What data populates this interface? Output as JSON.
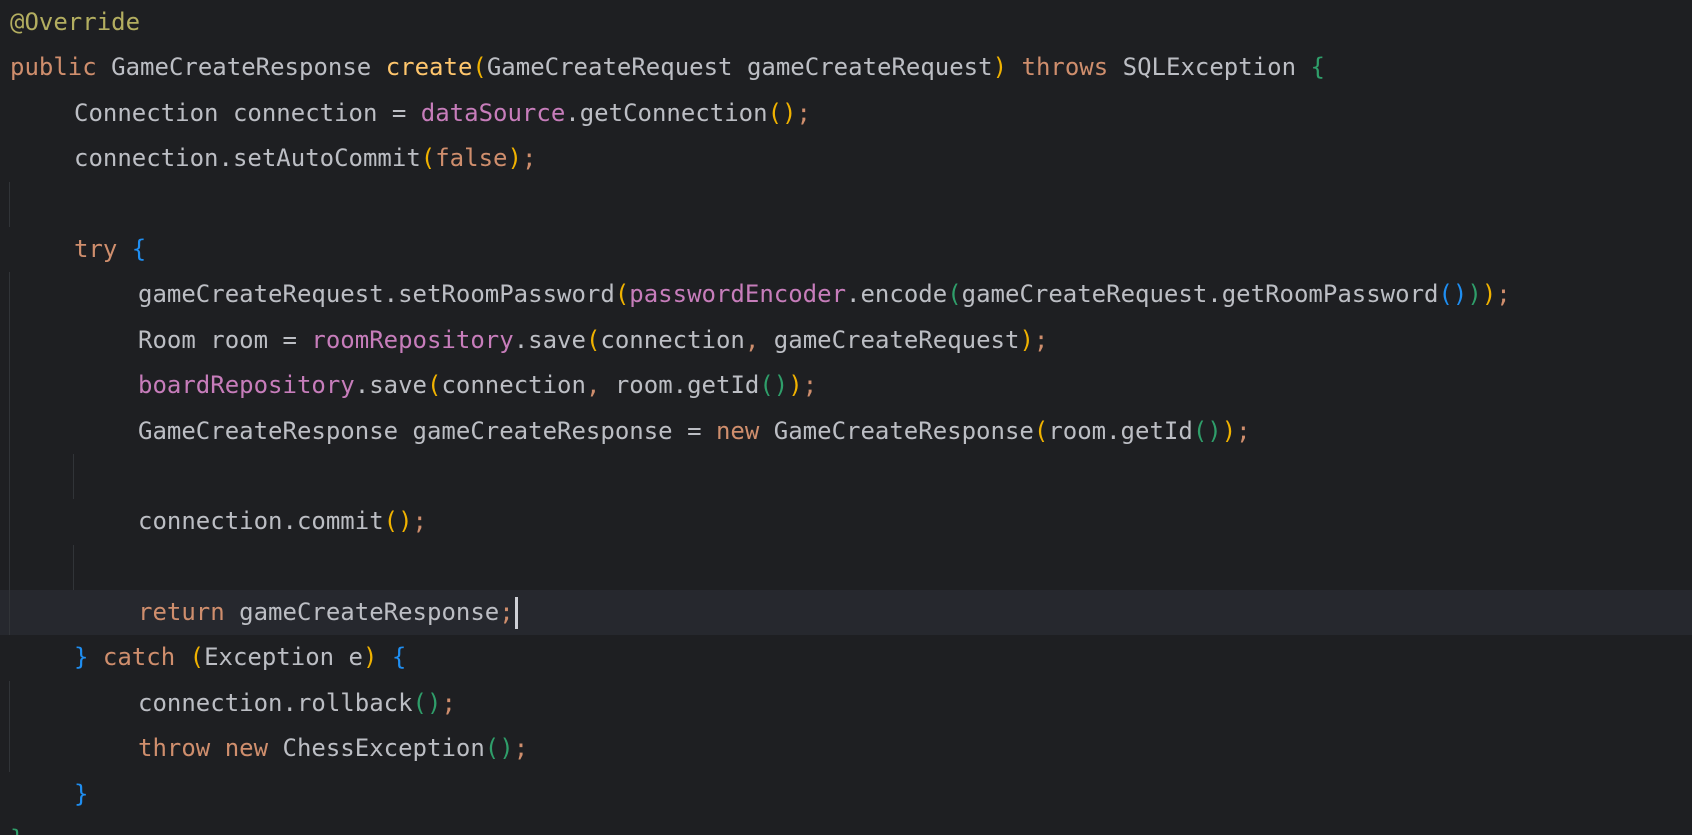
{
  "colors": {
    "background": "#1e1f22",
    "current_line": "#26282e",
    "default": "#bcbec4",
    "keyword": "#cf8e6d",
    "annotation": "#b3ae60",
    "method_decl": "#ffc66d",
    "field": "#c77dbb",
    "paren_1": "#f0b200",
    "paren_2": "#2f9e6a",
    "paren_3": "#1f8ef1"
  },
  "editor": {
    "current_line_index": 13,
    "lines": [
      {
        "indent": 0,
        "tokens": [
          {
            "t": "@Override",
            "c": "annotation"
          }
        ]
      },
      {
        "indent": 0,
        "tokens": [
          {
            "t": "public ",
            "c": "keyword"
          },
          {
            "t": "GameCreateResponse ",
            "c": "default"
          },
          {
            "t": "create",
            "c": "method_decl"
          },
          {
            "t": "(",
            "c": "paren_1"
          },
          {
            "t": "GameCreateRequest gameCreateRequest",
            "c": "default"
          },
          {
            "t": ")",
            "c": "paren_1"
          },
          {
            "t": " throws ",
            "c": "keyword"
          },
          {
            "t": "SQLException ",
            "c": "default"
          },
          {
            "t": "{",
            "c": "paren_2"
          }
        ]
      },
      {
        "indent": 1,
        "tokens": [
          {
            "t": "Connection connection = ",
            "c": "default"
          },
          {
            "t": "dataSource",
            "c": "field"
          },
          {
            "t": ".getConnection",
            "c": "default"
          },
          {
            "t": "()",
            "c": "paren_1"
          },
          {
            "t": ";",
            "c": "keyword"
          }
        ]
      },
      {
        "indent": 1,
        "tokens": [
          {
            "t": "connection.setAutoCommit",
            "c": "default"
          },
          {
            "t": "(",
            "c": "paren_1"
          },
          {
            "t": "false",
            "c": "keyword"
          },
          {
            "t": ")",
            "c": "paren_1"
          },
          {
            "t": ";",
            "c": "keyword"
          }
        ]
      },
      {
        "indent": 0,
        "tokens": []
      },
      {
        "indent": 1,
        "tokens": [
          {
            "t": "try ",
            "c": "keyword"
          },
          {
            "t": "{",
            "c": "paren_3"
          }
        ]
      },
      {
        "indent": 2,
        "tokens": [
          {
            "t": "gameCreateRequest.setRoomPassword",
            "c": "default"
          },
          {
            "t": "(",
            "c": "paren_1"
          },
          {
            "t": "passwordEncoder",
            "c": "field"
          },
          {
            "t": ".encode",
            "c": "default"
          },
          {
            "t": "(",
            "c": "paren_2"
          },
          {
            "t": "gameCreateRequest.getRoomPassword",
            "c": "default"
          },
          {
            "t": "()",
            "c": "paren_3"
          },
          {
            "t": ")",
            "c": "paren_2"
          },
          {
            "t": ")",
            "c": "paren_1"
          },
          {
            "t": ";",
            "c": "keyword"
          }
        ]
      },
      {
        "indent": 2,
        "tokens": [
          {
            "t": "Room room = ",
            "c": "default"
          },
          {
            "t": "roomRepository",
            "c": "field"
          },
          {
            "t": ".save",
            "c": "default"
          },
          {
            "t": "(",
            "c": "paren_1"
          },
          {
            "t": "connection",
            "c": "default"
          },
          {
            "t": ", ",
            "c": "keyword"
          },
          {
            "t": "gameCreateRequest",
            "c": "default"
          },
          {
            "t": ")",
            "c": "paren_1"
          },
          {
            "t": ";",
            "c": "keyword"
          }
        ]
      },
      {
        "indent": 2,
        "tokens": [
          {
            "t": "boardRepository",
            "c": "field"
          },
          {
            "t": ".save",
            "c": "default"
          },
          {
            "t": "(",
            "c": "paren_1"
          },
          {
            "t": "connection",
            "c": "default"
          },
          {
            "t": ", ",
            "c": "keyword"
          },
          {
            "t": "room.getId",
            "c": "default"
          },
          {
            "t": "()",
            "c": "paren_2"
          },
          {
            "t": ")",
            "c": "paren_1"
          },
          {
            "t": ";",
            "c": "keyword"
          }
        ]
      },
      {
        "indent": 2,
        "tokens": [
          {
            "t": "GameCreateResponse gameCreateResponse = ",
            "c": "default"
          },
          {
            "t": "new ",
            "c": "keyword"
          },
          {
            "t": "GameCreateResponse",
            "c": "default"
          },
          {
            "t": "(",
            "c": "paren_1"
          },
          {
            "t": "room.getId",
            "c": "default"
          },
          {
            "t": "()",
            "c": "paren_2"
          },
          {
            "t": ")",
            "c": "paren_1"
          },
          {
            "t": ";",
            "c": "keyword"
          }
        ]
      },
      {
        "indent": 0,
        "tokens": []
      },
      {
        "indent": 2,
        "tokens": [
          {
            "t": "connection.commit",
            "c": "default"
          },
          {
            "t": "()",
            "c": "paren_1"
          },
          {
            "t": ";",
            "c": "keyword"
          }
        ]
      },
      {
        "indent": 0,
        "tokens": []
      },
      {
        "indent": 2,
        "caret": true,
        "tokens": [
          {
            "t": "return ",
            "c": "keyword"
          },
          {
            "t": "gameCreateResponse",
            "c": "default"
          },
          {
            "t": ";",
            "c": "keyword"
          }
        ]
      },
      {
        "indent": 1,
        "tokens": [
          {
            "t": "}",
            "c": "paren_3"
          },
          {
            "t": " catch ",
            "c": "keyword"
          },
          {
            "t": "(",
            "c": "paren_1"
          },
          {
            "t": "Exception e",
            "c": "default"
          },
          {
            "t": ")",
            "c": "paren_1"
          },
          {
            "t": " ",
            "c": "default"
          },
          {
            "t": "{",
            "c": "paren_3"
          }
        ]
      },
      {
        "indent": 2,
        "tokens": [
          {
            "t": "connection.rollback",
            "c": "default"
          },
          {
            "t": "()",
            "c": "paren_2"
          },
          {
            "t": ";",
            "c": "keyword"
          }
        ]
      },
      {
        "indent": 2,
        "tokens": [
          {
            "t": "throw ",
            "c": "keyword"
          },
          {
            "t": "new ",
            "c": "keyword"
          },
          {
            "t": "ChessException",
            "c": "default"
          },
          {
            "t": "()",
            "c": "paren_2"
          },
          {
            "t": ";",
            "c": "keyword"
          }
        ]
      },
      {
        "indent": 1,
        "tokens": [
          {
            "t": "}",
            "c": "paren_3"
          }
        ]
      },
      {
        "indent": 0,
        "tokens": [
          {
            "t": "}",
            "c": "paren_2"
          }
        ]
      }
    ]
  }
}
